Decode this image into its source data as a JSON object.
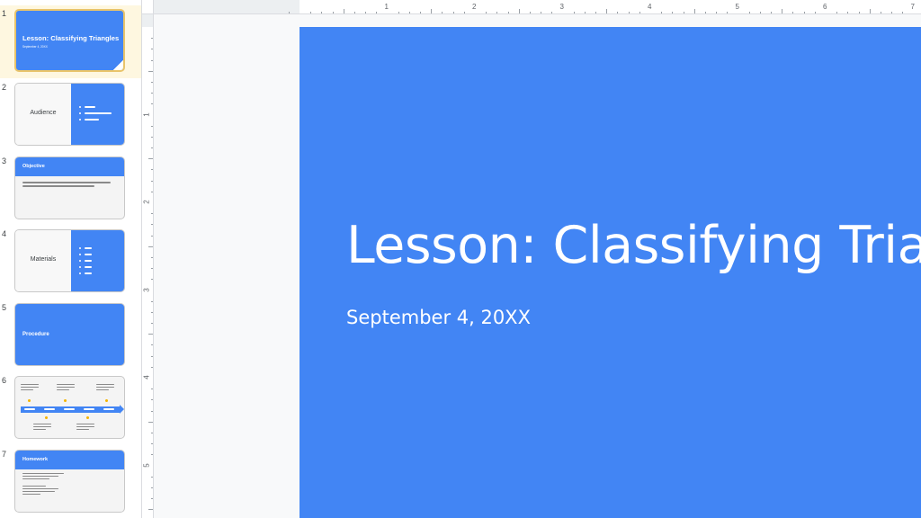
{
  "filmstrip": {
    "slides": [
      {
        "number": "1",
        "title": "Lesson: Classifying Triangles",
        "subtitle": "September 4, 20XX"
      },
      {
        "number": "2",
        "title": "Audience"
      },
      {
        "number": "3",
        "title": "Objective"
      },
      {
        "number": "4",
        "title": "Materials"
      },
      {
        "number": "5",
        "title": "Procedure"
      },
      {
        "number": "6"
      },
      {
        "number": "7",
        "title": "Homework"
      }
    ]
  },
  "ruler": {
    "horizontal": [
      "1",
      "2",
      "3",
      "4",
      "5",
      "6",
      "7"
    ],
    "vertical": [
      "1",
      "2",
      "3",
      "4",
      "5"
    ]
  },
  "slide": {
    "title": "Lesson: Classifying Triangles",
    "subtitle": "September 4, 20XX"
  },
  "colors": {
    "accent": "#4285f4",
    "selected_highlight": "#fef7e0",
    "selected_border": "#e9c46a"
  }
}
